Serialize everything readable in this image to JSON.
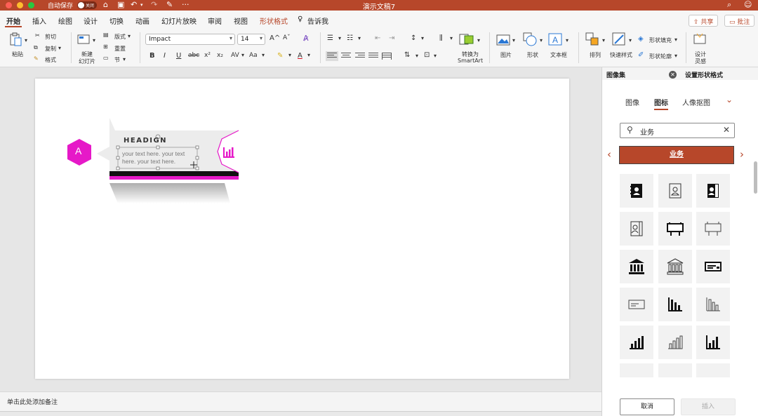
{
  "titlebar": {
    "autosave_label": "自动保存",
    "toggle_text": "关闭",
    "doc_title": "演示文稿7",
    "more": "···"
  },
  "tabs": [
    {
      "label": "开始"
    },
    {
      "label": "插入"
    },
    {
      "label": "绘图"
    },
    {
      "label": "设计"
    },
    {
      "label": "切换"
    },
    {
      "label": "动画"
    },
    {
      "label": "幻灯片放映"
    },
    {
      "label": "审阅"
    },
    {
      "label": "视图"
    },
    {
      "label": "形状格式"
    },
    {
      "label": "告诉我"
    }
  ],
  "actions": {
    "share": "共享",
    "comment": "批注"
  },
  "ribbon": {
    "paste": "粘贴",
    "cut": "剪切",
    "copy": "复制",
    "format": "格式",
    "new_slide_1": "新建",
    "new_slide_2": "幻灯片",
    "layout": "版式",
    "reset": "重置",
    "section": "节",
    "font_name": "Impact",
    "font_size": "14",
    "font_grow": "A^",
    "font_shrink": "Aˇ",
    "bold": "B",
    "italic": "I",
    "underline": "U",
    "strike": "abc",
    "superscript": "x²",
    "subscript": "x₂",
    "spacing": "AV",
    "case": "Aa",
    "convert_smartart_1": "转换为",
    "convert_smartart_2": "SmartArt",
    "picture": "图片",
    "shapes": "形状",
    "textbox": "文本框",
    "arrange": "排列",
    "quick_styles": "快速样式",
    "shape_fill": "形状填充",
    "shape_outline": "形状轮廓",
    "designer_1": "设计",
    "designer_2": "灵感"
  },
  "slide": {
    "badge_letter": "A",
    "heading": "HEADIGN",
    "body_text_1": "your text here. your text",
    "body_text_2": "here. your text here."
  },
  "notes": {
    "placeholder": "单击此处添加备注"
  },
  "pane": {
    "title_left": "图像集",
    "title_right": "设置形状格式",
    "tabs": [
      {
        "label": "图像"
      },
      {
        "label": "图标"
      },
      {
        "label": "人像抠图"
      }
    ],
    "search_value": "业务",
    "category": "业务",
    "icons": [
      "contact-book-filled-icon",
      "contact-book-outline-icon",
      "contact-card-filled-icon",
      "contact-card-outline-icon",
      "billboard-filled-icon",
      "billboard-outline-icon",
      "bank-filled-icon",
      "bank-outline-icon",
      "check-filled-icon",
      "check-outline-icon",
      "bar-chart-down-icon",
      "bar-chart-down-outline-icon",
      "bar-chart-up-icon",
      "bar-chart-up-outline-icon",
      "bar-chart-up-bold-icon"
    ],
    "cancel": "取消",
    "insert": "插入"
  },
  "colors": {
    "accent": "#b7472a",
    "magenta": "#e619c8"
  }
}
